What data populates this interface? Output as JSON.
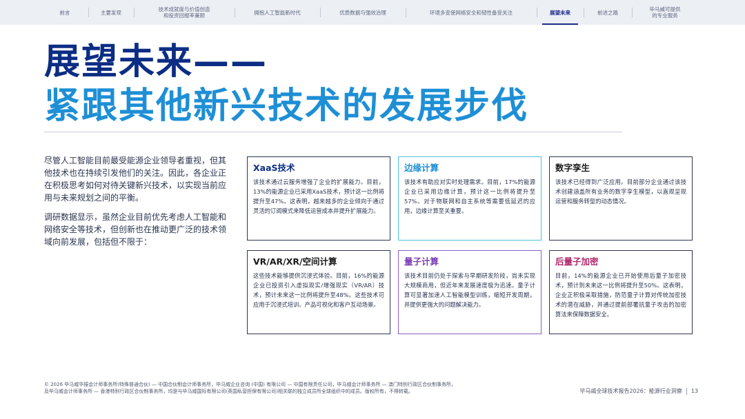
{
  "nav": {
    "items": [
      {
        "label": "前言"
      },
      {
        "label": "主要发现"
      },
      {
        "label": "技术成就度与价值创造\n和投资回报率兼顾"
      },
      {
        "label": "拥抱人工智能新时代"
      },
      {
        "label": "优质数据与强效治理"
      },
      {
        "label": "环境多变使网络安全和韧性备受关注"
      },
      {
        "label": "展望未来"
      },
      {
        "label": "前进之路"
      },
      {
        "label": "毕马威可提供\n的专业服务"
      }
    ],
    "active_index": 6
  },
  "title": {
    "line1": "展望未来——",
    "line2": "紧跟其他新兴技术的发展步伐"
  },
  "intro": {
    "p1": "尽管人工智能目前最受能源企业领导者重视，但其他技术也在持续引发他们的关注。因此，各企业正在积极思考如何对待关键新兴技术，以实现当前应用与未来规划之间的平衡。",
    "p2": "调研数据显示，虽然企业目前优先考虑人工智能和网络安全等技术，但创新也在推动更广泛的技术领域向前发展，包括但不限于："
  },
  "cards": [
    {
      "title": "XaaS技术",
      "body": "该技术通过云服务增强了企业的扩展能力。目前，13%的能源企业已采用XaaS技术，预计这一比例将提升至47%。这表明，越来越多的企业倾向于通过灵活的订阅模式来降低运营成本并提升扩展能力。"
    },
    {
      "title": "边缘计算",
      "body": "该技术有助应对实时处理需求。目前，17%的能源企业已采用边缘计算，预计这一比例将提升至57%。对于物联网和自主系统等需要低延迟的应用，边缘计算至关重要。"
    },
    {
      "title": "数字孪生",
      "body": "该技术已经得到广泛应用。目前部分企业通过该技术创建涵盖所有业务的数字孪生模型，以直观呈现运营和服务转型的动态情况。"
    },
    {
      "title": "VR/AR/XR/空间计算",
      "body": "这些技术能够提供沉浸式体验。目前，16%的能源企业已投资引入虚拟现实/增强现实（VR/AR）技术，预计未来这一比例将提升至48%。这些技术可应用于沉浸式培训、产品可视化和客户互动场景。"
    },
    {
      "title": "量子计算",
      "body": "该技术目前仍处于探索与早期研发阶段，尚未实现大规模商用，但近年来发展速度极为迅速。量子计算可显著加速人工智能模型训练，缩短开发周期，并提供更强大的问题解决能力。"
    },
    {
      "title": "后量子加密",
      "body": "目前，14%的能源企业已开始使用后量子加密技术，预计到未来这一比例将提升至50%。这表明，企业正积极采取措施，防范量子计算对传统加密技术的潜在威胁，并通过提前部署抗量子攻击的加密算法来保障数据安全。"
    }
  ],
  "footer": {
    "copyright": "© 2026 毕马威华振会计师事务所(特殊普通合伙) — 中国合伙制会计师事务所，毕马威企业咨询 (中国) 有限公司 — 中国有限责任公司，毕马威会计师事务所 — 澳门特别行政区合伙制事务所，及毕马威会计师事务所 — 香港特别行政区合伙制事务所，均是与毕马威国际有限公司(英国私营担保有限公司)相关联的独立成员所全球组织中的成员。版权所有，不得转载。",
    "report": "毕马威全球技术报告2026：能源行业洞察",
    "page": "13"
  },
  "colors": {
    "title_dark": "#0c2d83",
    "title_light": "#1e8fd6",
    "purple": "#7b3fb5",
    "teal_border": "#4ec0d8"
  }
}
